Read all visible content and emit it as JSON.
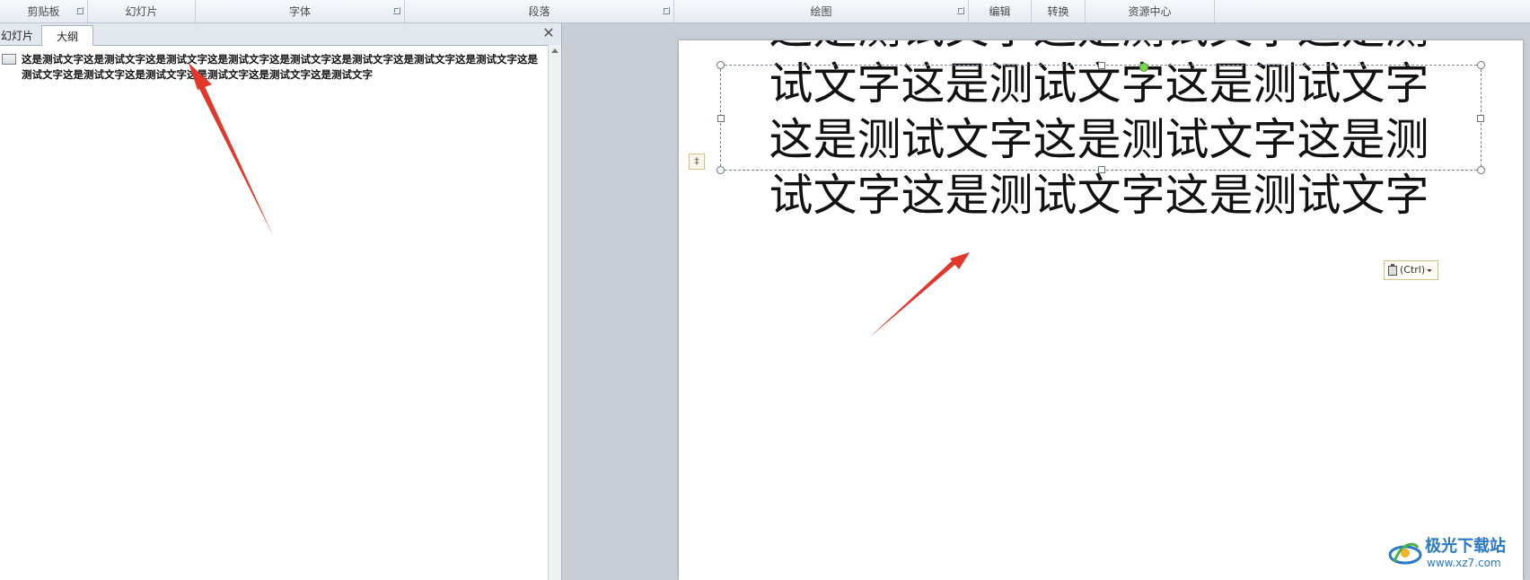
{
  "ribbon": {
    "groups": [
      {
        "label": "剪贴板"
      },
      {
        "label": "幻灯片"
      },
      {
        "label": "字体"
      },
      {
        "label": "段落"
      },
      {
        "label": "绘图"
      },
      {
        "label": "编辑"
      },
      {
        "label": "转换"
      },
      {
        "label": "资源中心"
      }
    ]
  },
  "left_pane": {
    "tabs": [
      {
        "label": "幻灯片"
      },
      {
        "label": "大纲"
      }
    ],
    "active_tab": "大纲",
    "close_symbol": "✕",
    "outline_text": "这是测试文字这是测试文字这是测试文字这是测试文字这是测试文字这是测试文字这是测试文字这是测试文字这是测试文字这是测试文字这是测试文字这是测试文字这是测试文字这是测试文字"
  },
  "slide": {
    "body_text": "这是测试文字这是测试文字这是测试文字这是测试文字这是测试文字这是测试文字这是测试文字这是测试文字这是测试文字这是测试文字",
    "paste_options_label": "(Ctrl)",
    "autofit_symbol": "‡"
  },
  "watermark": {
    "title": "极光下载站",
    "url": "www.xz7.com"
  },
  "colors": {
    "annotation_arrow": "#e2382b",
    "rotate_handle": "#7dd650",
    "watermark_blue": "#2a78c8"
  }
}
